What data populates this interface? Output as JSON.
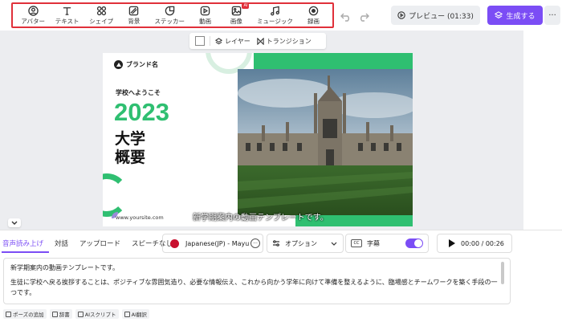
{
  "toolbar": {
    "tools": [
      {
        "label": "アバター",
        "icon": "avatar-icon"
      },
      {
        "label": "テキスト",
        "icon": "text-icon"
      },
      {
        "label": "シェイプ",
        "icon": "shape-icon"
      },
      {
        "label": "背景",
        "icon": "background-icon"
      },
      {
        "label": "ステッカー",
        "icon": "sticker-icon"
      },
      {
        "label": "動画",
        "icon": "video-icon"
      },
      {
        "label": "画像",
        "icon": "image-icon",
        "badge": "AI"
      },
      {
        "label": "ミュージック",
        "icon": "music-icon"
      },
      {
        "label": "録画",
        "icon": "record-icon"
      }
    ],
    "preview_label": "プレビュー (01:33)",
    "generate_label": "生成する",
    "more_label": "···",
    "accent_color": "#7b4df5"
  },
  "canvas_bar": {
    "layer_label": "レイヤー",
    "transition_label": "トランジション"
  },
  "slide": {
    "brand": "ブランド名",
    "welcome": "学校へようこそ",
    "year": "2023",
    "title_line1": "大学",
    "title_line2": "概要",
    "site": "www.yoursite.com",
    "caption": "新学期案内の動画テンプレートです。",
    "green_color": "#2fbf71"
  },
  "bottom": {
    "tabs": [
      "音声読み上げ",
      "対話",
      "アップロード",
      "スピーチなし"
    ],
    "voice": "Japanese(JP) - Mayu",
    "voice_more": "···",
    "option_label": "オプション",
    "subtitle_label": "字幕",
    "cc_label": "CC",
    "time": "00:00 / 00:26",
    "script_line1": "新学期案内の動画テンプレートです。",
    "script_line2": "生徒に学校へ戻る挨拶することは、ポジティブな雰囲気造り、必要な情報伝え、これから向かう学年に向けて準備を整えるように、臨場感とチームワークを築く手段の一つです。",
    "tools": [
      "ポーズの追加",
      "辞書",
      "AIスクリプト",
      "AI翻訳"
    ]
  }
}
